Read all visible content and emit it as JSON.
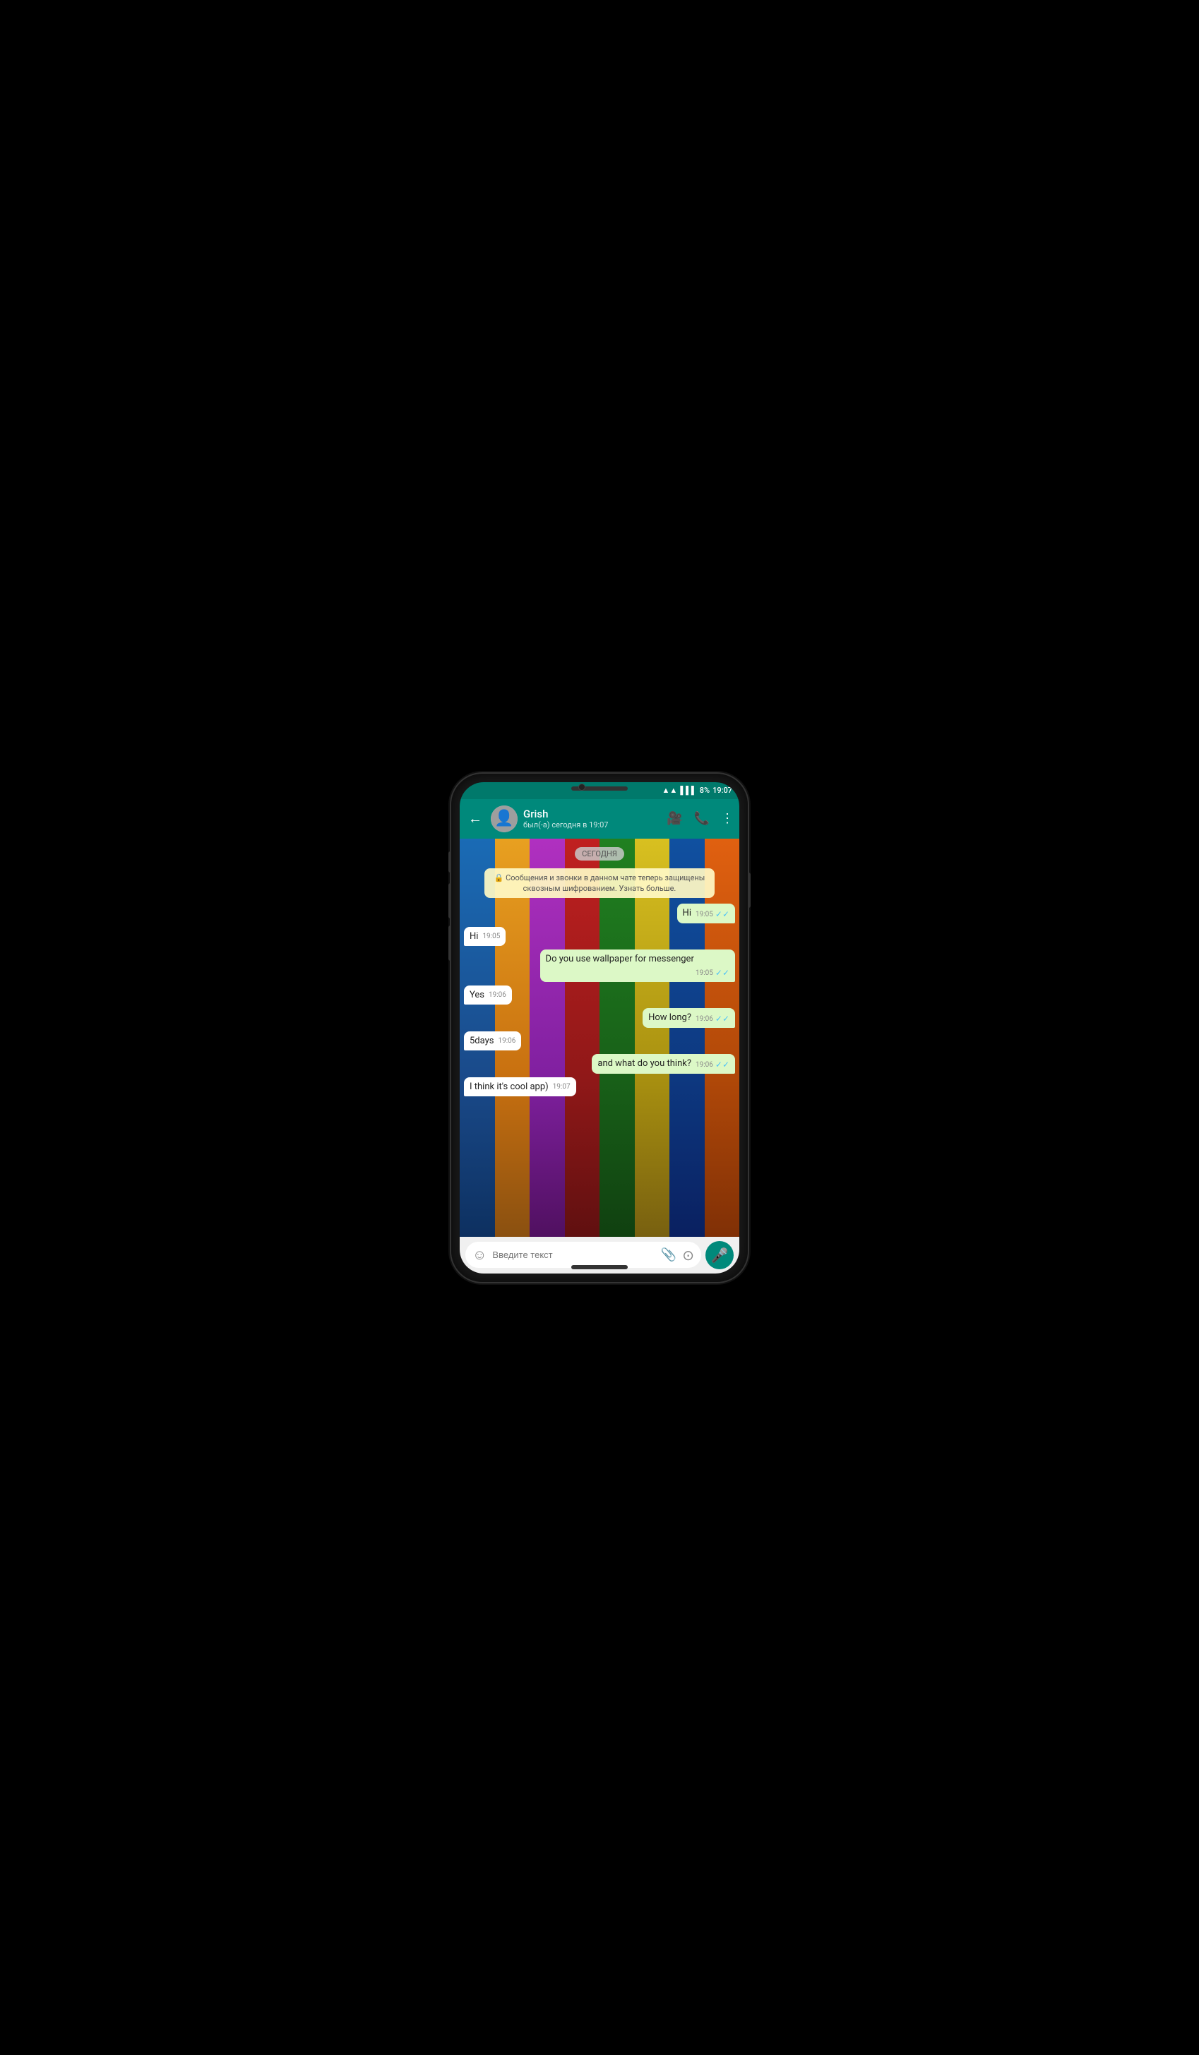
{
  "statusBar": {
    "wifi": "📶",
    "signal": "📶",
    "battery": "8%",
    "time": "19:07"
  },
  "header": {
    "backLabel": "←",
    "contactName": "Grish",
    "contactStatus": "был(-а) сегодня в 19:07",
    "videoIcon": "📹",
    "phoneIcon": "📞",
    "moreIcon": "⋮"
  },
  "chat": {
    "dateBadge": "СЕГОДНЯ",
    "systemMessage": "🔒 Сообщения и звонки в данном чате теперь защищены сквозным шифрованием. Узнать больше.",
    "messages": [
      {
        "id": 1,
        "type": "sent",
        "text": "Hi",
        "time": "19:05",
        "checks": "✓✓"
      },
      {
        "id": 2,
        "type": "received",
        "text": "Hi",
        "time": "19:05"
      },
      {
        "id": 3,
        "type": "sent",
        "text": "Do you use wallpaper for messenger",
        "time": "19:05",
        "checks": "✓✓"
      },
      {
        "id": 4,
        "type": "received",
        "text": "Yes",
        "time": "19:06"
      },
      {
        "id": 5,
        "type": "sent",
        "text": "How long?",
        "time": "19:06",
        "checks": "✓✓"
      },
      {
        "id": 6,
        "type": "received",
        "text": "5days",
        "time": "19:06"
      },
      {
        "id": 7,
        "type": "sent",
        "text": "and what do you think?",
        "time": "19:06",
        "checks": "✓✓"
      },
      {
        "id": 8,
        "type": "received",
        "text": "I think it's cool app)",
        "time": "19:07"
      }
    ]
  },
  "inputBar": {
    "placeholder": "Введите текст",
    "emojiIcon": "😊",
    "attachIcon": "📎",
    "cameraIcon": "📷",
    "micIcon": "🎤"
  },
  "wallpaper": {
    "stripes": [
      "#1565C0",
      "#F9A825",
      "#6A1B9A",
      "#C62828",
      "#1B5E20",
      "#F57F17",
      "#0D47A1",
      "#E65100"
    ],
    "floorColor": "#212121"
  }
}
